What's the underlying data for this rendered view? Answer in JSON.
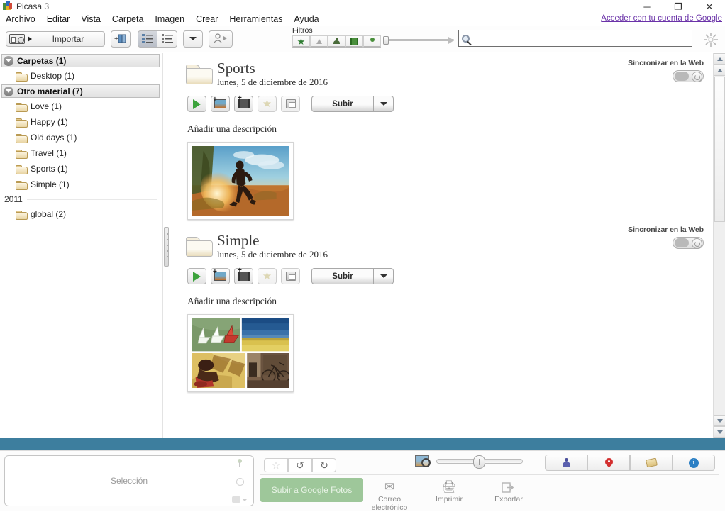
{
  "window": {
    "title": "Picasa 3",
    "app_icon": "picasa-logo-icon",
    "minimize": "─",
    "maximize": "❐",
    "close": "✕"
  },
  "menubar": {
    "items": [
      {
        "label": "Archivo"
      },
      {
        "label": "Editar"
      },
      {
        "label": "Vista"
      },
      {
        "label": "Carpeta"
      },
      {
        "label": "Imagen"
      },
      {
        "label": "Crear"
      },
      {
        "label": "Herramientas"
      },
      {
        "label": "Ayuda"
      }
    ],
    "google_account_link": "Acceder con tu cuenta de Google"
  },
  "toolbar": {
    "import_label": "Importar",
    "filters_label": "Filtros",
    "filter_buttons": [
      {
        "name": "filter-starred",
        "icon": "star-icon"
      },
      {
        "name": "filter-uploaded",
        "icon": "upload-arrow-icon"
      },
      {
        "name": "filter-faces",
        "icon": "person-icon"
      },
      {
        "name": "filter-videos",
        "icon": "film-icon"
      },
      {
        "name": "filter-geotagged",
        "icon": "map-pin-icon"
      }
    ],
    "search_placeholder": "",
    "search_value": ""
  },
  "sidebar": {
    "groups": [
      {
        "name": "carpetas",
        "label": "Carpetas (1)",
        "items": [
          {
            "label": "Desktop (1)"
          }
        ]
      },
      {
        "name": "otro-material",
        "label": "Otro material (7)",
        "items": [
          {
            "label": "Love (1)"
          },
          {
            "label": "Happy (1)"
          },
          {
            "label": "Old days (1)"
          },
          {
            "label": "Travel (1)"
          },
          {
            "label": "Sports (1)"
          },
          {
            "label": "Simple (1)"
          }
        ]
      }
    ],
    "year_separator": "2011",
    "year_items": [
      {
        "label": "global (2)"
      }
    ]
  },
  "albums": [
    {
      "name": "sports",
      "title": "Sports",
      "date": "lunes, 5 de diciembre de 2016",
      "upload_label": "Subir",
      "description_placeholder": "Añadir una descripción",
      "sync_label": "Sincronizar en la Web",
      "sync_state": "off",
      "thumbnail": "runner-at-sunset-photo"
    },
    {
      "name": "simple",
      "title": "Simple",
      "date": "lunes, 5 de diciembre de 2016",
      "upload_label": "Subir",
      "description_placeholder": "Añadir una descripción",
      "sync_label": "Sincronizar en la Web",
      "sync_state": "off",
      "thumbnail": "four-photo-collage"
    }
  ],
  "bottom": {
    "tray_label": "Selección",
    "upload_google_label": "Subir a Google Fotos",
    "actions": [
      {
        "name": "email",
        "label": "Correo electrónico",
        "icon": "envelope-icon"
      },
      {
        "name": "print",
        "label": "Imprimir",
        "icon": "printer-icon"
      },
      {
        "name": "export",
        "label": "Exportar",
        "icon": "export-icon"
      }
    ],
    "view_buttons": [
      {
        "name": "people-view",
        "icon": "person-icon"
      },
      {
        "name": "places-view",
        "icon": "map-pin-icon"
      },
      {
        "name": "tags-view",
        "icon": "tag-icon"
      },
      {
        "name": "info-view",
        "icon": "info-icon"
      }
    ],
    "rotate_left_glyph": "↺",
    "rotate_right_glyph": "↻",
    "star_glyph": "☆"
  },
  "colors": {
    "status_strip": "#3d7e9e",
    "upload_button": "#9ec79a",
    "link": "#6a32a8"
  }
}
